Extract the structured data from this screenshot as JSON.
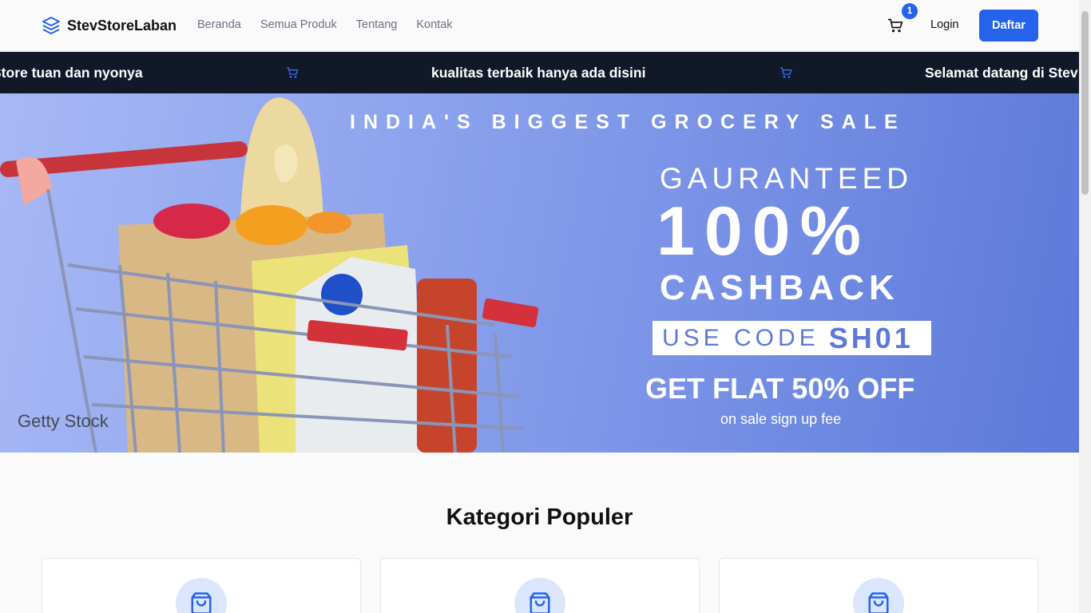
{
  "header": {
    "brand": "StevStoreLaban",
    "nav": [
      "Beranda",
      "Semua Produk",
      "Tentang",
      "Kontak"
    ],
    "cart_count": "1",
    "login_label": "Login",
    "register_label": "Daftar"
  },
  "marquee": {
    "items": [
      "Store tuan dan nyonya",
      "kualitas terbaik hanya ada disini",
      "Selamat datang di Stev"
    ]
  },
  "hero": {
    "subtitle": "INDIA'S BIGGEST GROCERY SALE",
    "guaranteed": "GAURANTEED",
    "percent": "100%",
    "cashback": "CASHBACK",
    "code_label": "USE CODE",
    "code": "SH01",
    "flat": "GET FLAT 50% OFF",
    "fine_print": "on sale sign up fee",
    "watermark": "Getty Stock"
  },
  "categories": {
    "title": "Kategori Populer"
  },
  "colors": {
    "primary": "#2563eb",
    "marquee_bg": "#111827",
    "hero_bg": "#7891e6"
  }
}
